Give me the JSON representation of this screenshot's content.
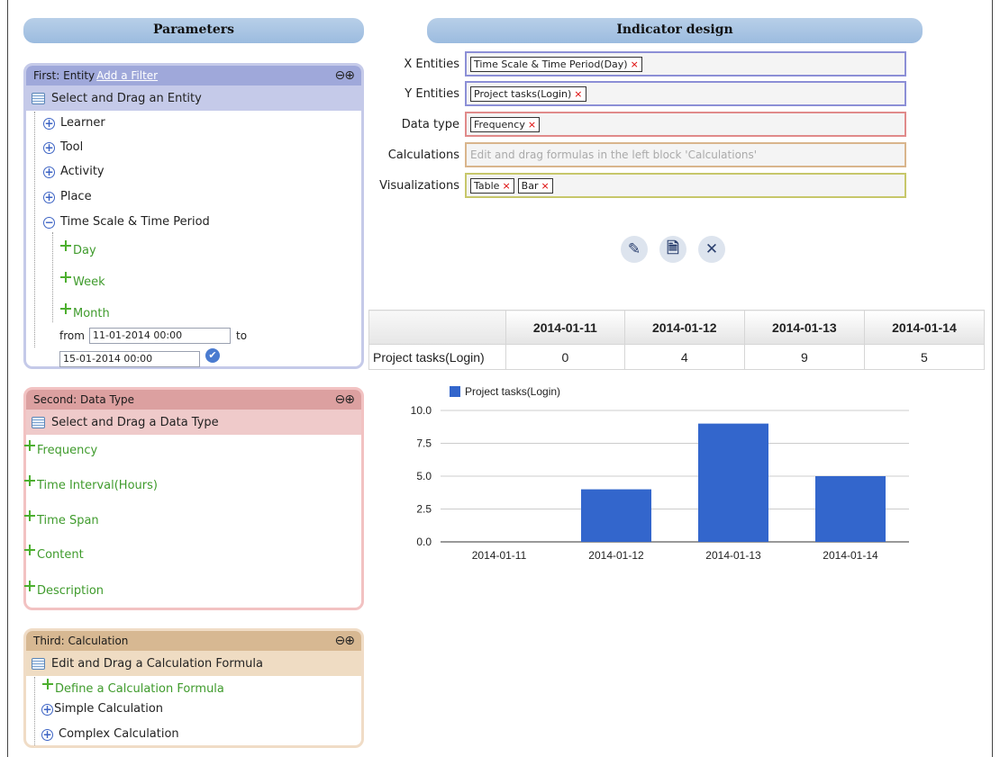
{
  "left_header": "Parameters",
  "right_header": "Indicator design",
  "panel1": {
    "title": "First: Entity",
    "filter_link": "Add a Filter",
    "toggles": "⊖⊕",
    "subtitle": "Select and Drag an Entity",
    "items": [
      "Learner",
      "Tool",
      "Activity",
      "Place",
      "Time Scale & Time Period"
    ],
    "period_items": [
      "Day",
      "Week",
      "Month"
    ],
    "from_label": "from",
    "to_label": "to",
    "from_value": "11-01-2014 00:00",
    "to_value": "15-01-2014 00:00"
  },
  "panel2": {
    "title": "Second: Data Type",
    "toggles": "⊖⊕",
    "subtitle": "Select and Drag a Data Type",
    "items": [
      "Frequency",
      "Time Interval(Hours)",
      "Time Span",
      "Content",
      "Description"
    ]
  },
  "panel3": {
    "title": "Third: Calculation",
    "toggles": "⊖⊕",
    "subtitle": "Edit and Drag a Calculation Formula",
    "items": [
      "Define a Calculation Formula",
      "Simple Calculation",
      "Complex Calculation"
    ]
  },
  "design": {
    "x_label": "X Entities",
    "x_chip": "Time Scale & Time Period(Day)",
    "y_label": "Y Entities",
    "y_chip": "Project tasks(Login)",
    "dtype_label": "Data type",
    "dtype_chip": "Frequency",
    "calc_label": "Calculations",
    "calc_placeholder": "Edit and drag formulas in the left block 'Calculations'",
    "viz_label": "Visualizations",
    "viz_chips": [
      "Table",
      "Bar"
    ],
    "chip_remove": "×",
    "actions": [
      "✎",
      "🗎",
      "✕"
    ],
    "colors": {
      "x_border": "#8c8fd6",
      "y_border": "#8c8fd6",
      "dtype_border": "#e08a8a",
      "calc_border": "#d9b58c",
      "viz_border": "#c7c76a"
    }
  },
  "table": {
    "headers": [
      "",
      "2014-01-11",
      "2014-01-12",
      "2014-01-13",
      "2014-01-14"
    ],
    "rows": [
      [
        "Project tasks(Login)",
        "0",
        "4",
        "9",
        "5"
      ]
    ]
  },
  "chart_data": {
    "type": "bar",
    "categories": [
      "2014-01-11",
      "2014-01-12",
      "2014-01-13",
      "2014-01-14"
    ],
    "series": [
      {
        "name": "Project tasks(Login)",
        "values": [
          0,
          4,
          9,
          5
        ],
        "color": "#3366cc"
      }
    ],
    "yticks": [
      "0.0",
      "2.5",
      "5.0",
      "7.5",
      "10.0"
    ],
    "ylim": [
      0,
      10
    ],
    "legend": "top-left",
    "grid": true
  }
}
